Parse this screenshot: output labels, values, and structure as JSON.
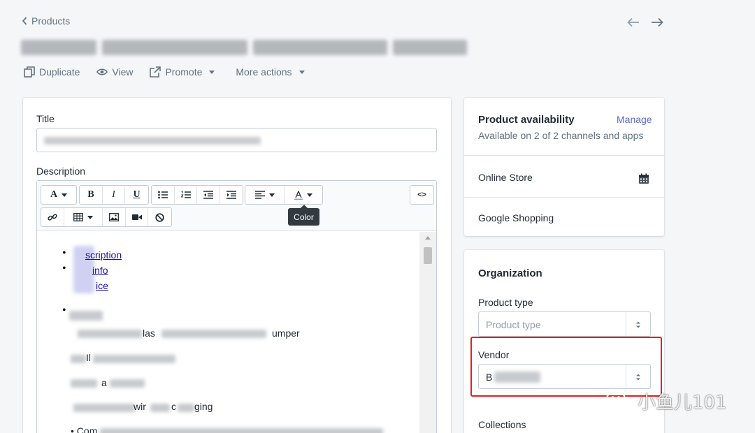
{
  "header": {
    "back_label": "Products",
    "actions": {
      "duplicate": "Duplicate",
      "view": "View",
      "promote": "Promote",
      "more": "More actions"
    }
  },
  "main": {
    "title_label": "Title",
    "description_label": "Description",
    "toolbar": {
      "font_btn": "A",
      "bold": "B",
      "italic": "I",
      "underline": "U",
      "html_btn": "<>",
      "color_tooltip": "Color"
    },
    "content": {
      "links": [
        "scription",
        "info",
        "ice"
      ],
      "line_fragments": [
        "las",
        "umper",
        "Il",
        "a",
        "wir",
        "c",
        "ging",
        "Com"
      ]
    }
  },
  "availability": {
    "title": "Product availability",
    "manage": "Manage",
    "subtitle": "Available on 2 of 2 channels and apps",
    "channels": [
      "Online Store",
      "Google Shopping"
    ]
  },
  "organization": {
    "title": "Organization",
    "product_type_label": "Product type",
    "product_type_placeholder": "Product type",
    "vendor_label": "Vendor",
    "vendor_value": "B",
    "collections_label": "Collections"
  },
  "watermark": {
    "text": "小鱼儿101"
  },
  "colors": {
    "accent": "#5c6ac4",
    "highlight": "#e02020",
    "link": "#1a0dab"
  }
}
